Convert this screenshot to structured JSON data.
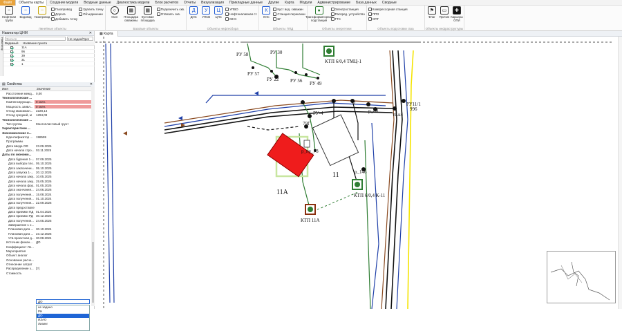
{
  "menu": {
    "items": [
      "Файл",
      "Объекты карты",
      "Создание модели",
      "Входные данные",
      "Диагностика модели",
      "Блок расчетов",
      "Отчеты",
      "Визуализация",
      "Прикладные данные",
      "Другие",
      "Карта",
      "Модули",
      "Администрирование",
      "База данных",
      "Сводные"
    ],
    "file_index": 0,
    "active_index": 1
  },
  "ribbon": {
    "linear": {
      "label": "Линейные объекты",
      "big": [
        {
          "label": "Нефтяная труба",
          "icon": "~"
        },
        {
          "label": "Водовод",
          "icon": "~"
        },
        {
          "label": "Газопровод",
          "icon": "~"
        }
      ],
      "small": [
        "Газопровод",
        "Дорога",
        "Добавить точку",
        "Удалить точку",
        "Объединение"
      ]
    },
    "base": {
      "label": "Базовые объекты",
      "big": [
        {
          "label": "Узел",
          "icon": "○"
        },
        {
          "label": "Площадка скважины",
          "icon": "▦"
        },
        {
          "label": "Кустовая площадка",
          "icon": "▦"
        }
      ],
      "small": [
        "Подключить скв.",
        "Отвязать скв."
      ]
    },
    "oil": {
      "label": "Объекты нефтесбора",
      "big": [
        {
          "label": "ДНС",
          "icon": "Д"
        },
        {
          "label": "УПСВ",
          "icon": "У"
        },
        {
          "label": "ЦПС",
          "icon": "Ц"
        }
      ],
      "small": [
        "УПВО",
        "Нефтеналивная ст.",
        "МНС"
      ]
    },
    "ppd": {
      "label": "Объекты ППД",
      "big": [
        {
          "label": "КНС",
          "icon": "К"
        }
      ],
      "small": [
        "Куст вод. скважин",
        "Станция перекачки",
        "БГ"
      ]
    },
    "energy": {
      "label": "Объекты энергетики",
      "big": [
        {
          "label": "Трансформаторная подстанция",
          "icon": "●"
        }
      ],
      "small": [
        "Электростанция",
        "Распред. устройство",
        "ГТС"
      ]
    },
    "gas": {
      "label": "Объекты подготовки газа",
      "small": [
        "Компрессорная станция",
        "ППЗ",
        "ОПГ"
      ]
    },
    "infra": {
      "label": "Объекты инфраструктуры",
      "big": [
        {
          "label": "Флаг",
          "icon": "⚑"
        },
        {
          "label": "Прочие",
          "icon": "▭"
        },
        {
          "label": "Карьеры ОПИ",
          "icon": "✚"
        }
      ]
    }
  },
  "navigator": {
    "title": "Навигатор ЦНМ",
    "filter_placeholder": "Фильтр",
    "mode": "Не задан/Прог",
    "side_tab": "Навигатор",
    "columns": [
      "Видимый",
      "Название пункта"
    ],
    "rows": [
      "11А",
      "96",
      "39",
      "31",
      "1"
    ]
  },
  "properties": {
    "title": "Свойства",
    "columns": [
      "Имя",
      "Значение"
    ],
    "rows": [
      {
        "k": "Расстояние межд...",
        "v": "0,00",
        "t": "p"
      },
      {
        "k": "Технологические ...",
        "v": "",
        "t": "h"
      },
      {
        "k": "Компенсирующи...",
        "v": "0 знач.",
        "t": "p",
        "c": "red"
      },
      {
        "k": "Мощность заявл...",
        "v": "0 знач.",
        "t": "p",
        "c": "red"
      },
      {
        "k": "Отход максимал...",
        "v": "2228,14",
        "t": "p"
      },
      {
        "k": "Отход средний, м",
        "v": "1294,09",
        "t": "p"
      },
      {
        "k": "Технологические ...",
        "v": "",
        "t": "h"
      },
      {
        "k": "Тип группы",
        "v": "Многопластовый грунт",
        "t": "p"
      },
      {
        "k": "Характеристики ...",
        "v": "",
        "t": "h"
      },
      {
        "k": "Экономические п...",
        "v": "",
        "t": "h"
      },
      {
        "k": "Идентификатор ...",
        "v": "198599",
        "t": "p"
      },
      {
        "k": "Программы",
        "v": "",
        "t": "p"
      },
      {
        "k": "Дата ввода ОФ",
        "v": "23.09.2026",
        "t": "p"
      },
      {
        "k": "Дата начала стро...",
        "v": "03.11.2025",
        "t": "p"
      },
      {
        "k": "Даты по экономо...",
        "v": "",
        "t": "h"
      },
      {
        "k": "Дата бурения 1-...",
        "v": "07.09.2025",
        "t": "q"
      },
      {
        "k": "Дата выбора пло...",
        "v": "05.10.2025",
        "t": "q"
      },
      {
        "k": "Дата заключени...",
        "v": "05.10.2025",
        "t": "q"
      },
      {
        "k": "Дата запуска 1-...",
        "v": "20.12.2025",
        "t": "q"
      },
      {
        "k": "Дата начала заку...",
        "v": "10.05.2025",
        "t": "q"
      },
      {
        "k": "Дата начала заку...",
        "v": "25.05.2026",
        "t": "q"
      },
      {
        "k": "Дата начала фор...",
        "v": "01.05.2025",
        "t": "q"
      },
      {
        "k": "Дата окончания...",
        "v": "24.06.2026",
        "t": "q"
      },
      {
        "k": "Дата получения...",
        "v": "15.08.2024",
        "t": "q"
      },
      {
        "k": "Дата получения...",
        "v": "01.10.2024",
        "t": "q"
      },
      {
        "k": "Дата получения...",
        "v": "22.09.2026",
        "t": "q"
      },
      {
        "k": "Дата предоставле...",
        "v": "",
        "t": "q"
      },
      {
        "k": "Дата приемки ПД",
        "v": "01.04.2024",
        "t": "q"
      },
      {
        "k": "Дата приемки РД",
        "v": "30.12.2023",
        "t": "q"
      },
      {
        "k": "Дата получения...",
        "v": "24.05.2025",
        "t": "q"
      },
      {
        "k": "Завершение 1 э...",
        "v": "",
        "t": "q"
      },
      {
        "k": "Плановая дата ...",
        "v": "30.10.2024",
        "t": "q"
      },
      {
        "k": "Плановая дата ...",
        "v": "23.12.2025",
        "t": "q"
      },
      {
        "k": "Утв.проектная д...",
        "v": "30.08.2024",
        "t": "q"
      },
      {
        "k": "Источник финан...",
        "v": "ДО",
        "t": "p"
      },
      {
        "k": "Коэффициент Ле...",
        "v": "",
        "t": "p"
      },
      {
        "k": "Мероприятия",
        "v": "",
        "t": "p"
      },
      {
        "k": "Объект аналог",
        "v": "",
        "t": "p"
      },
      {
        "k": "Основание расче...",
        "v": "",
        "t": "p"
      },
      {
        "k": "Отнесение затрат",
        "v": "",
        "t": "p"
      },
      {
        "k": "Распределение з...",
        "v": "[?]",
        "t": "p"
      },
      {
        "k": "Стоимость",
        "v": "",
        "t": "p",
        "c": "redd"
      }
    ],
    "dropdown_value": "ДО",
    "dropdown_options": [
      "не задано",
      "РН",
      "ДО",
      "ИЗАО",
      "Лизинг"
    ],
    "dropdown_selected": 2
  },
  "map": {
    "tab": "Карта",
    "labels": {
      "ru58": "РУ 58",
      "ru30": "РУ 30",
      "ru57": "РУ 57",
      "ru22": "РУ 22",
      "ru56": "РУ 56",
      "ru49": "РУ 49",
      "ktp1": "КТП 6/0,4  ТМЦ-1",
      "ru4": "РУ-4",
      "ru79": "79Г",
      "pu73": "р_пу_73",
      "ru88": "р_88",
      "ru96": "996",
      "ru1": "РУ11/1",
      "ru146": "р_146",
      "num11": "11",
      "num11a": "11А",
      "ktp11": "КТП 6/0,4 К-11",
      "ktp11a": "КТП 11А",
      "lb2": "2",
      "tk": "тв.к4"
    }
  }
}
